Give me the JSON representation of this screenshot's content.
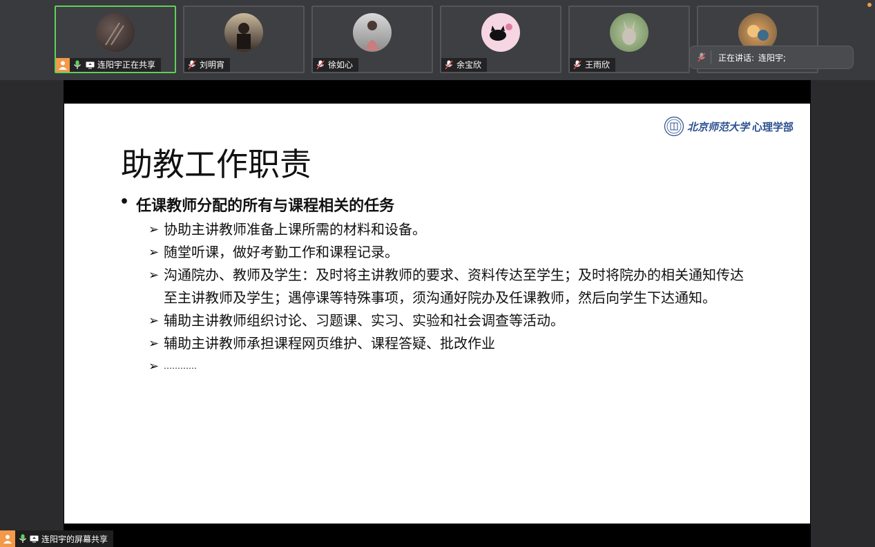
{
  "participants": [
    {
      "name": "连阳宇正在共享",
      "active": true
    },
    {
      "name": "刘明宵",
      "active": false
    },
    {
      "name": "徐如心",
      "active": false
    },
    {
      "name": "余宝欣",
      "active": false
    },
    {
      "name": "王雨欣",
      "active": false
    },
    {
      "name": "",
      "active": false
    }
  ],
  "speaking": {
    "label": "正在讲话:",
    "name": "连阳宇;"
  },
  "slide": {
    "logo_school": "北京师范大学",
    "logo_dept": "心理学部",
    "title": "助教工作职责",
    "bullet": "任课教师分配的所有与课程相关的任务",
    "items": [
      "协助主讲教师准备上课所需的材料和设备。",
      "随堂听课，做好考勤工作和课程记录。",
      "沟通院办、教师及学生：及时将主讲教师的要求、资料传达至学生；及时将院办的相关通知传达至主讲教师及学生；遇停课等特殊事项，须沟通好院办及任课教师，然后向学生下达通知。",
      "辅助主讲教师组织讨论、习题课、实习、实验和社会调查等活动。",
      "辅助主讲教师承担课程网页维护、课程答疑、批改作业",
      "…………"
    ]
  },
  "bottom_bar": {
    "label": "连阳宇的屏幕共享"
  },
  "colors": {
    "active_border": "#5fd15a",
    "badge": "#f2994a",
    "logo": "#2b4f8f"
  }
}
